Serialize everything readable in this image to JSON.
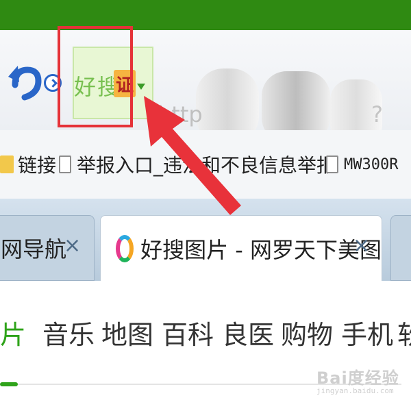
{
  "address_bar": {
    "search_engine_name": "好搜",
    "cert_badge": "证",
    "url_prefix": "http",
    "url_tail": "?&sr"
  },
  "bookmarks": [
    {
      "label": "链接",
      "icon": "folder-icon"
    },
    {
      "label": "举报入口_违法和不良信息举报中心",
      "icon": "page-icon"
    },
    {
      "label": "MW300R",
      "icon": "page-icon"
    }
  ],
  "tabs": [
    {
      "title": "网导航",
      "close": "×",
      "active": false
    },
    {
      "title": "好搜图片 - 网罗天下美图",
      "close": "×",
      "active": true
    }
  ],
  "site_nav": {
    "items": [
      "片",
      "音乐",
      "地图",
      "百科",
      "良医",
      "购物",
      "手机",
      "软"
    ],
    "active_index": 0
  },
  "watermark": {
    "logo": "Bai度经验",
    "url": "jingyan.baidu.com"
  },
  "colors": {
    "top_bar": "#2f8a12",
    "highlight": "#e53238",
    "accent_green": "#2fa31a"
  }
}
